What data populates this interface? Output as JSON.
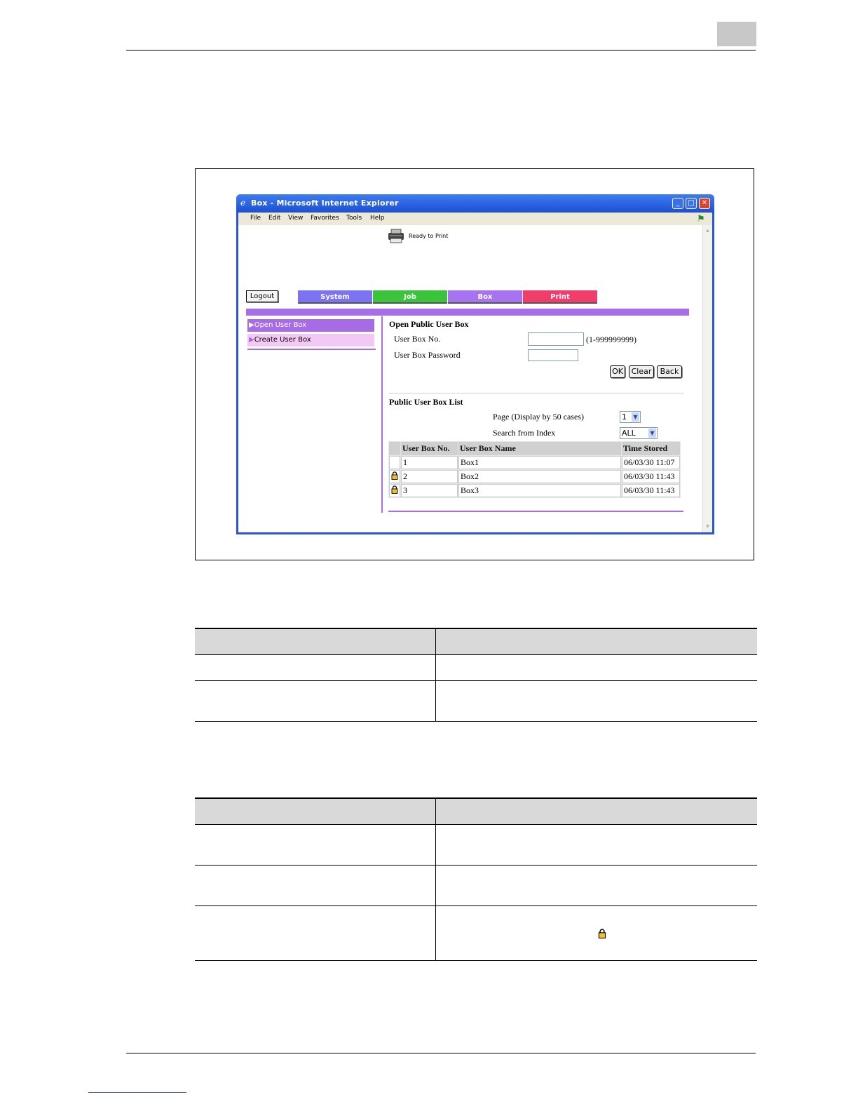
{
  "window": {
    "title": "Box - Microsoft Internet Explorer",
    "menu": [
      "File",
      "Edit",
      "View",
      "Favorites",
      "Tools",
      "Help"
    ],
    "controls": {
      "minimize": "_",
      "maximize": "□",
      "close": "✕"
    }
  },
  "header": {
    "status": "Ready to Print",
    "logout_label": "Logout",
    "tabs": [
      {
        "label": "System",
        "color": "#7b73f2"
      },
      {
        "label": "Job",
        "color": "#3bc43b"
      },
      {
        "label": "Box",
        "color": "#a873f0"
      },
      {
        "label": "Print",
        "color": "#f03d6c"
      }
    ]
  },
  "sidebar": {
    "items": [
      {
        "label": "Open User Box"
      },
      {
        "label": "Create User Box"
      }
    ]
  },
  "open_box": {
    "title": "Open Public User Box",
    "box_no_label": "User Box No.",
    "box_no_hint": "(1-999999999)",
    "box_no_value": "",
    "password_label": "User Box Password",
    "password_value": "",
    "ok_label": "OK",
    "clear_label": "Clear",
    "back_label": "Back"
  },
  "box_list": {
    "title": "Public User Box List",
    "page_label": "Page (Display by 50 cases)",
    "page_value": "1",
    "index_label": "Search from Index",
    "index_value": "ALL",
    "columns": [
      "User Box No.",
      "User Box Name",
      "Time Stored"
    ],
    "rows": [
      {
        "locked": false,
        "no": "1",
        "name": "Box1",
        "time": "06/03/30 11:07"
      },
      {
        "locked": true,
        "no": "2",
        "name": "Box2",
        "time": "06/03/30 11:43"
      },
      {
        "locked": true,
        "no": "3",
        "name": "Box3",
        "time": "06/03/30 11:43"
      }
    ]
  }
}
